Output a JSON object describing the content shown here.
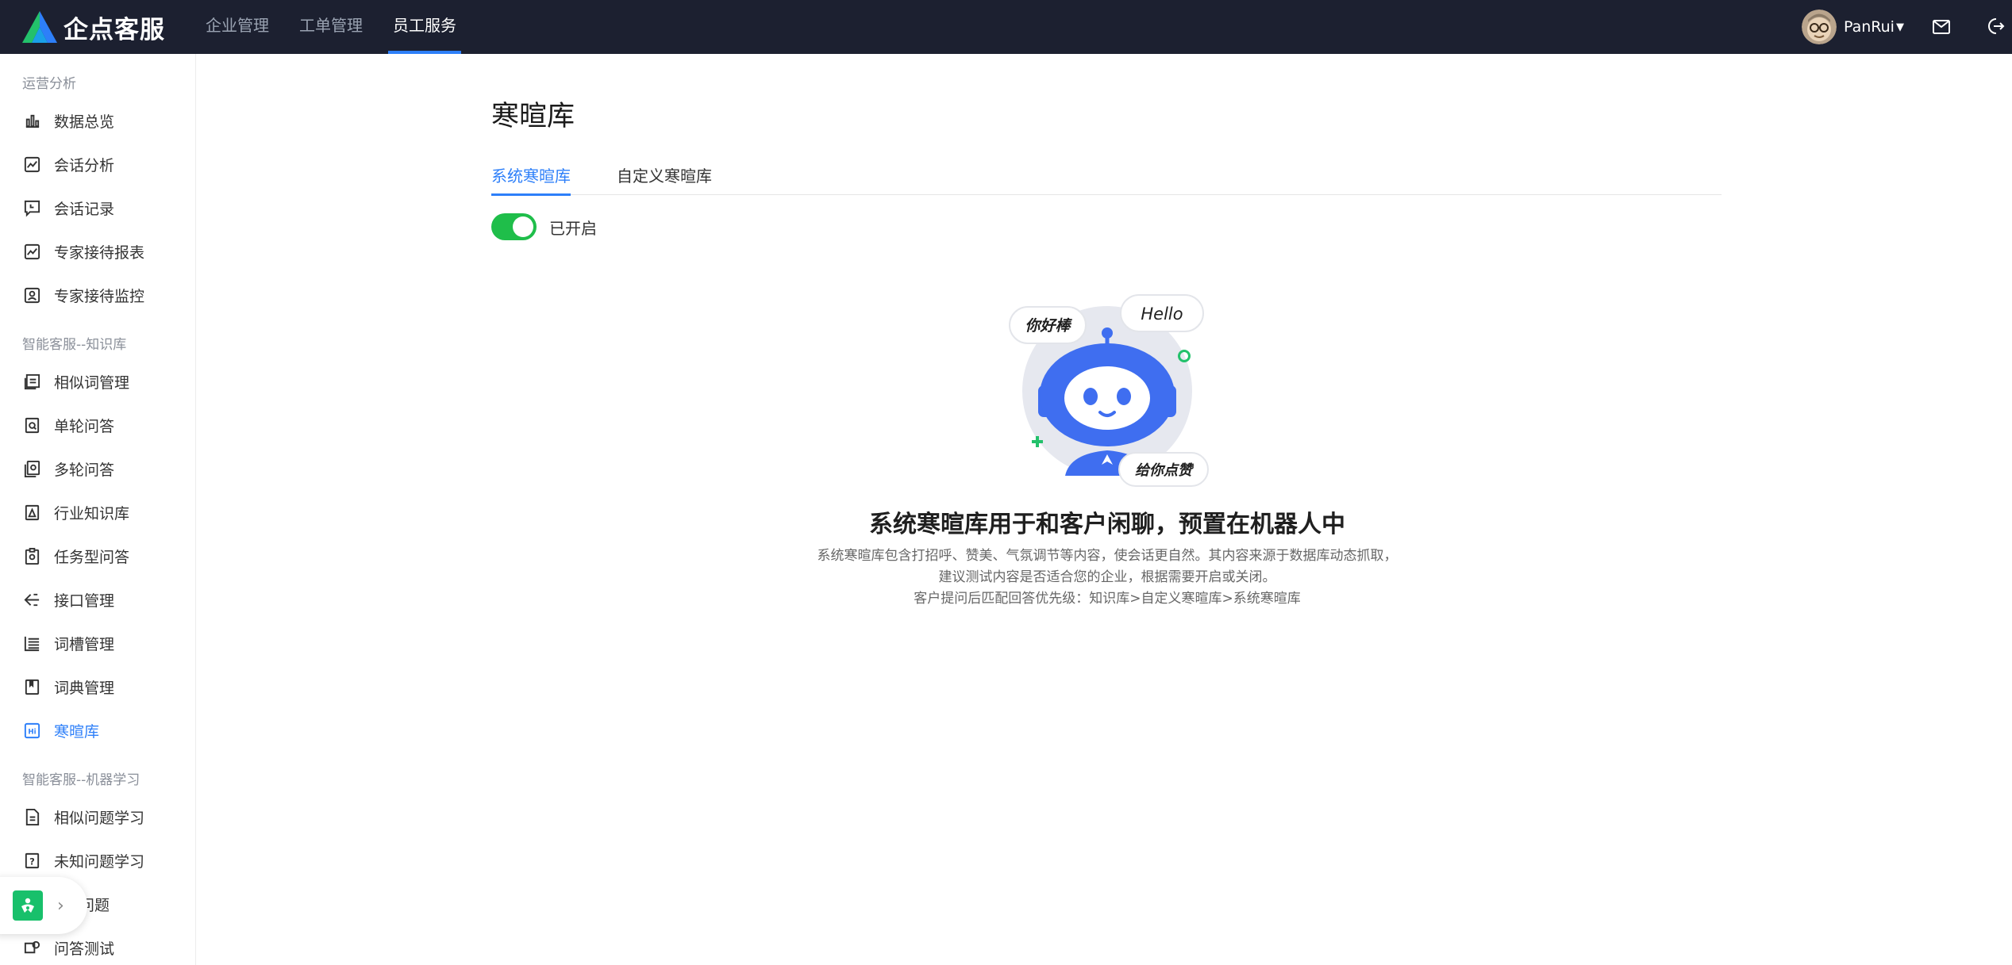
{
  "header": {
    "brand": "企点客服",
    "nav": [
      {
        "label": "企业管理"
      },
      {
        "label": "工单管理"
      },
      {
        "label": "员工服务"
      }
    ],
    "username": "PanRui",
    "colors": {
      "bar": "#1c2030",
      "accent": "#2d7ff9"
    }
  },
  "sidebar": {
    "groups": [
      {
        "label": "运营分析"
      },
      {
        "label": "智能客服--知识库"
      },
      {
        "label": "智能客服--机器学习"
      }
    ],
    "items": [
      {
        "label": "数据总览",
        "icon": "bar-chart-icon"
      },
      {
        "label": "会话分析",
        "icon": "line-chart-icon"
      },
      {
        "label": "会话记录",
        "icon": "record-icon"
      },
      {
        "label": "专家接待报表",
        "icon": "report-icon"
      },
      {
        "label": "专家接待监控",
        "icon": "monitor-icon"
      },
      {
        "label": "相似词管理",
        "icon": "synonym-icon"
      },
      {
        "label": "单轮问答",
        "icon": "single-qa-icon"
      },
      {
        "label": "多轮问答",
        "icon": "multi-qa-icon"
      },
      {
        "label": "行业知识库",
        "icon": "industry-kb-icon"
      },
      {
        "label": "任务型问答",
        "icon": "task-qa-icon"
      },
      {
        "label": "接口管理",
        "icon": "api-icon"
      },
      {
        "label": "词槽管理",
        "icon": "slot-icon"
      },
      {
        "label": "词典管理",
        "icon": "dictionary-icon"
      },
      {
        "label": "寒暄库",
        "icon": "greeting-icon",
        "active": true
      },
      {
        "label": "相似问题学习",
        "icon": "similar-learn-icon"
      },
      {
        "label": "未知问题学习",
        "icon": "unknown-learn-icon"
      },
      {
        "label": "问题",
        "icon": "question-icon"
      },
      {
        "label": "问答测试",
        "icon": "qa-test-icon"
      }
    ]
  },
  "main": {
    "title": "寒暄库",
    "tabs": [
      {
        "label": "系统寒暄库",
        "active": true
      },
      {
        "label": "自定义寒暄库",
        "active": false
      }
    ],
    "switch": {
      "label": "已开启",
      "on": true
    },
    "illustration": {
      "bubbles": {
        "left": "你好棒",
        "right": "Hello",
        "bottom": "给你点赞"
      }
    },
    "empty_title": "系统寒暄库用于和客户闲聊，预置在机器人中",
    "empty_desc": [
      "系统寒暄库包含打招呼、赞美、气氛调节等内容，使会话更自然。其内容来源于数据库动态抓取，",
      "建议测试内容是否适合您的企业，根据需要开启或关闭。",
      "客户提问后匹配回答优先级：知识库>自定义寒暄库>系统寒暄库"
    ]
  }
}
